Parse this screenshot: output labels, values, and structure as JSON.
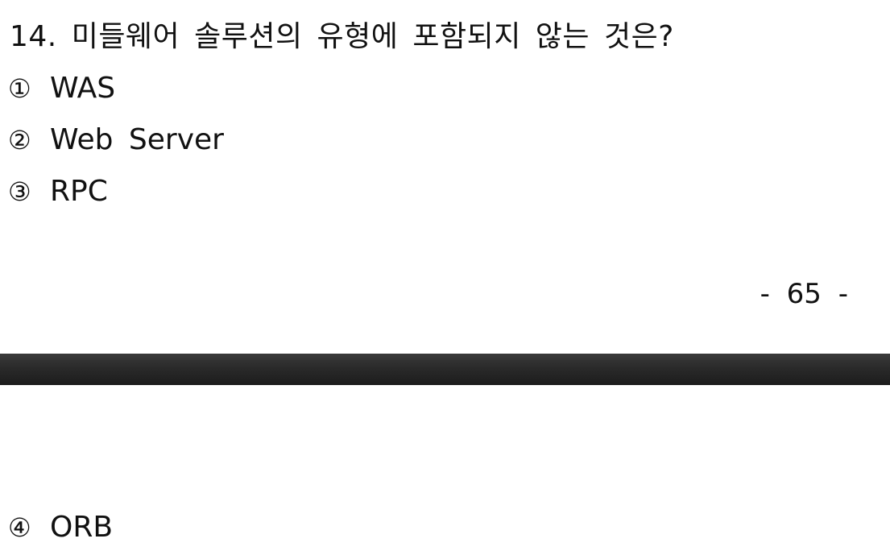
{
  "question": {
    "text": "14. 미들웨어 솔루션의 유형에 포함되지 않는 것은?"
  },
  "options": [
    {
      "marker": "①",
      "text": "WAS"
    },
    {
      "marker": "②",
      "text": "Web Server"
    },
    {
      "marker": "③",
      "text": "RPC"
    },
    {
      "marker": "④",
      "text": "ORB"
    }
  ],
  "page_number": "- 65 -",
  "colors": {
    "text": "#111111",
    "background": "#ffffff",
    "divider": "#2a2a2a"
  }
}
